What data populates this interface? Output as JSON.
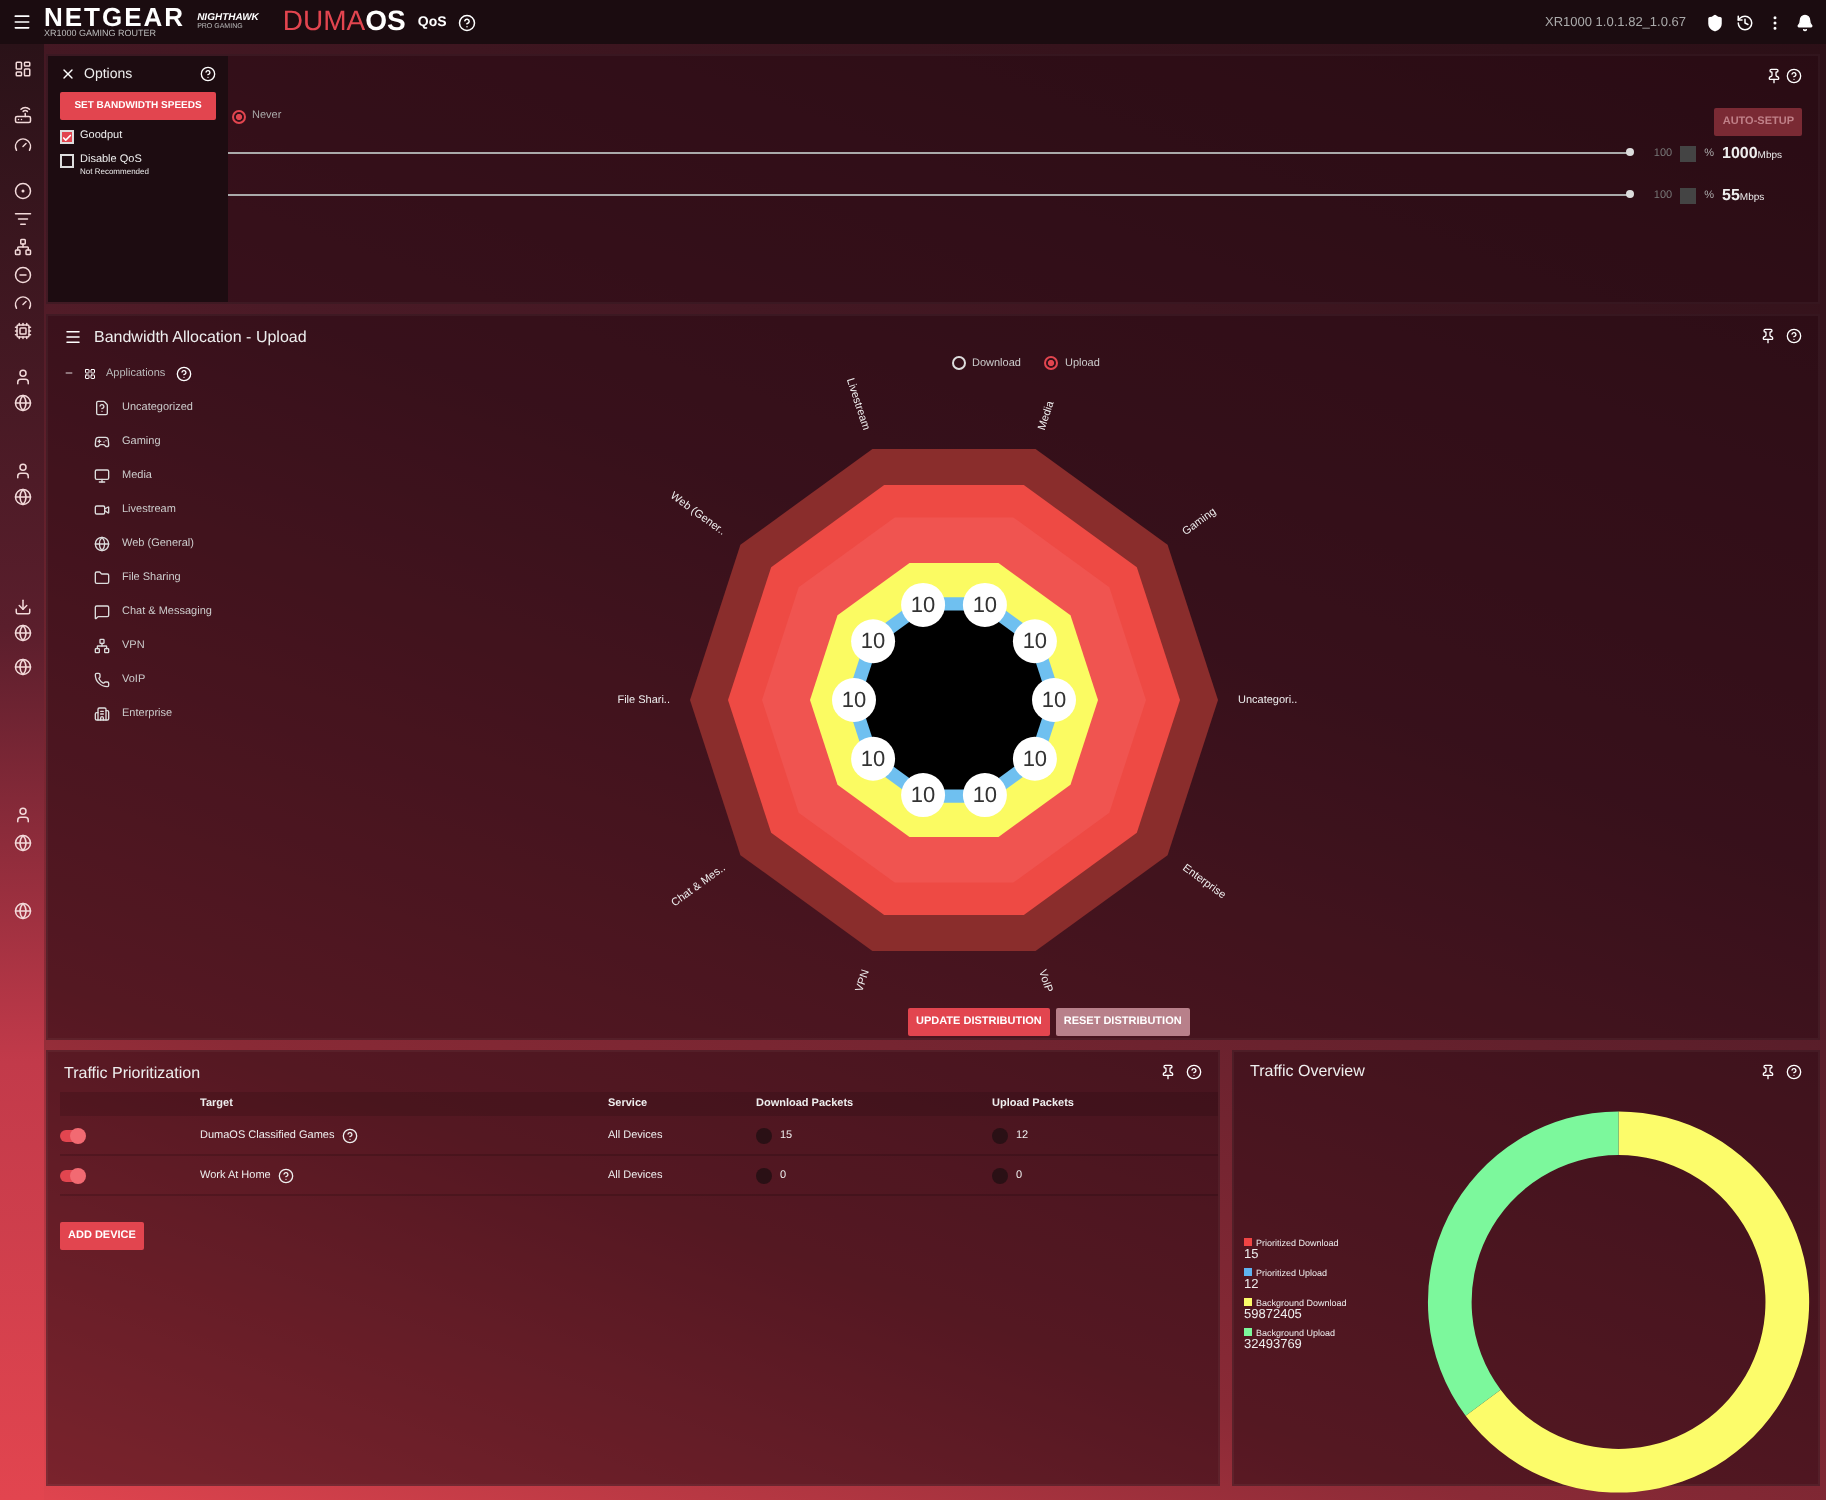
{
  "header": {
    "brand": "NETGEAR",
    "model": "XR1000 GAMING ROUTER",
    "sub_brand": "NIGHTHAWK",
    "sub_brand_tag": "PRO GAMING",
    "product_a": "DUMA",
    "product_b": "OS",
    "page": "QoS",
    "firmware": "XR1000 1.0.1.82_1.0.67"
  },
  "options": {
    "title": "Options",
    "button": "SET BANDWIDTH SPEEDS",
    "checks": [
      {
        "label": "Goodput",
        "checked": true
      },
      {
        "label": "Disable QoS",
        "note": "Not Recommended",
        "checked": false
      }
    ]
  },
  "speeds": {
    "schedule": {
      "label": "Never",
      "selected": true
    },
    "auto_button": "AUTO-SETUP",
    "rows": [
      {
        "level": 1,
        "percent": "100",
        "unit_sign": "%",
        "value": "1000",
        "unit": "Mbps"
      },
      {
        "level": 1,
        "percent": "100",
        "unit_sign": "%",
        "value": "55",
        "unit": "Mbps"
      }
    ]
  },
  "allocation": {
    "title": "Bandwidth Allocation - Upload",
    "group": "Applications",
    "items": [
      "Uncategorized",
      "Gaming",
      "Media",
      "Livestream",
      "Web (General)",
      "File Sharing",
      "Chat & Messaging",
      "VPN",
      "VoIP",
      "Enterprise"
    ],
    "legend": [
      {
        "label": "Download",
        "selected": false
      },
      {
        "label": "Upload",
        "selected": true
      }
    ],
    "axes": [
      "Livestream",
      "Media",
      "Web (Gener..",
      "Gaming",
      "File Shari..",
      "Uncategori..",
      "Chat & Mes..",
      "Enterprise",
      "VPN",
      "VoIP"
    ],
    "values": [
      "10",
      "10",
      "10",
      "10",
      "10",
      "10",
      "10",
      "10",
      "10",
      "10"
    ],
    "buttons": [
      {
        "label": "UPDATE DISTRIBUTION",
        "kind": "primary"
      },
      {
        "label": "RESET DISTRIBUTION",
        "kind": "secondary"
      }
    ]
  },
  "prioritization": {
    "title": "Traffic Prioritization",
    "columns": [
      "Target",
      "Service",
      "Download Packets",
      "Upload Packets"
    ],
    "rows": [
      {
        "on": true,
        "target": "DumaOS Classified Games",
        "service": "All Devices",
        "download": "15",
        "upload": "12"
      },
      {
        "on": true,
        "target": "Work At Home",
        "service": "All Devices",
        "download": "0",
        "upload": "0"
      }
    ],
    "button": "ADD DEVICE"
  },
  "overview": {
    "title": "Traffic Overview",
    "legend": [
      {
        "label": "Prioritized Download",
        "value": "15",
        "color": "#ef4444"
      },
      {
        "label": "Prioritized Upload",
        "value": "12",
        "color": "#5fb4f0"
      },
      {
        "label": "Background Download",
        "value": "59872405",
        "color": "#fcfc6a"
      },
      {
        "label": "Background Upload",
        "value": "32493769",
        "color": "#7cf89c"
      }
    ]
  }
}
